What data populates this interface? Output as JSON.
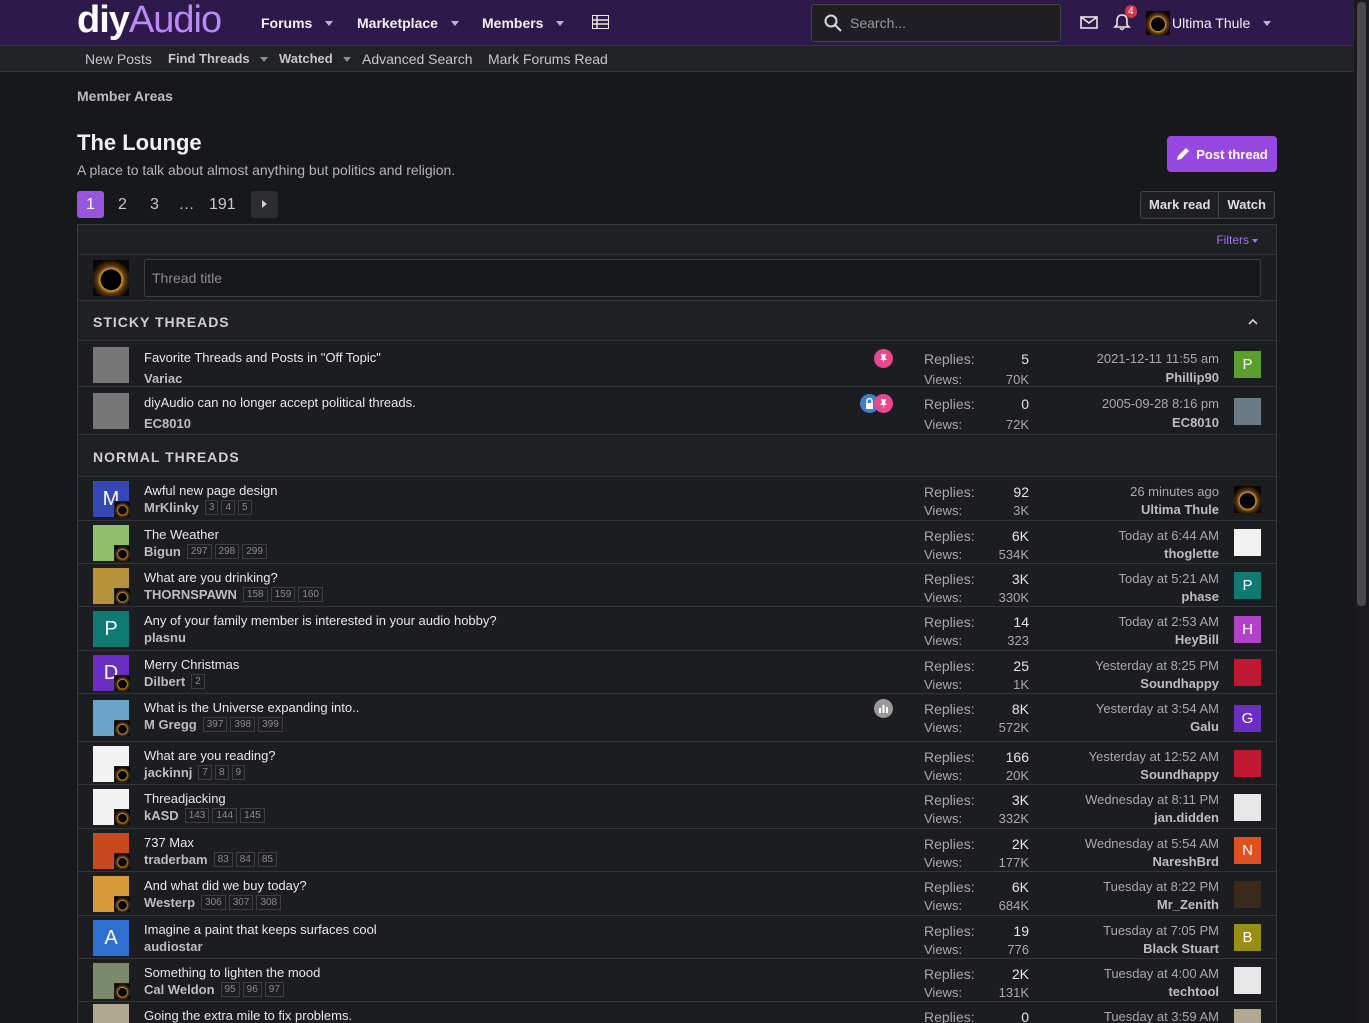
{
  "header": {
    "logo_a": "diy",
    "logo_b": "Audio",
    "nav": [
      "Forums",
      "Marketplace",
      "Members"
    ],
    "search_placeholder": "Search...",
    "notifications_count": "4",
    "username": "Ultima Thule"
  },
  "subnav": {
    "new_posts": "New Posts",
    "find_threads": "Find Threads",
    "watched": "Watched",
    "advanced_search": "Advanced Search",
    "mark_forums_read": "Mark Forums Read"
  },
  "breadcrumb": "Member Areas",
  "page": {
    "title": "The Lounge",
    "description": "A place to talk about almost anything but politics and religion.",
    "post_thread": "Post thread",
    "mark_read": "Mark read",
    "watch": "Watch"
  },
  "pager": [
    "1",
    "2",
    "3",
    "…",
    "191"
  ],
  "filters": "Filters",
  "thread_title_placeholder": "Thread title",
  "sections": {
    "sticky": "STICKY THREADS",
    "normal": "NORMAL THREADS"
  },
  "labels": {
    "replies": "Replies:",
    "views": "Views:"
  },
  "sticky_threads": [
    {
      "title": "Favorite Threads and Posts in \"Off Topic\"",
      "author": "Variac",
      "replies": "5",
      "views": "70K",
      "date": "2021-12-11 11:55 am",
      "last": "Phillip90",
      "last_initial": "P",
      "last_color": "#5a9e2e",
      "icons": [
        "pin"
      ]
    },
    {
      "title": "diyAudio can no longer accept political threads.",
      "author": "EC8010",
      "replies": "0",
      "views": "72K",
      "date": "2005-09-28 8:16 pm",
      "last": "EC8010",
      "last_initial": "",
      "last_color": "#6b7b86",
      "icons": [
        "lock",
        "pin"
      ]
    }
  ],
  "normal_threads": [
    {
      "title": "Awful new page design",
      "author": "MrKlinky",
      "pages": [
        "3",
        "4",
        "5"
      ],
      "replies": "92",
      "views": "3K",
      "date": "26 minutes ago",
      "last": "Ultima Thule",
      "av_initial": "M",
      "av_color": "#3548b8",
      "last_initial": "",
      "last_color": "eclipse"
    },
    {
      "title": "The Weather",
      "author": "Bigun",
      "pages": [
        "297",
        "298",
        "299"
      ],
      "replies": "6K",
      "views": "534K",
      "date": "Today at 6:44 AM",
      "last": "thoglette",
      "av_initial": "",
      "av_color": "#8fbf6a",
      "last_initial": "",
      "last_color": "#f2f2f2"
    },
    {
      "title": "What are you drinking?",
      "author": "THORNSPAWN",
      "pages": [
        "158",
        "159",
        "160"
      ],
      "replies": "3K",
      "views": "330K",
      "date": "Today at 5:21 AM",
      "last": "phase",
      "av_initial": "",
      "av_color": "#b8923a",
      "last_initial": "P",
      "last_color": "#0f7a72"
    },
    {
      "title": "Any of your family member is interested in your audio hobby?",
      "author": "plasnu",
      "pages": [],
      "replies": "14",
      "views": "323",
      "date": "Today at 2:53 AM",
      "last": "HeyBill",
      "av_initial": "P",
      "av_color": "#0f7a72",
      "last_initial": "H",
      "last_color": "#b042c8"
    },
    {
      "title": "Merry Christmas",
      "author": "Dilbert",
      "pages": [
        "2"
      ],
      "replies": "25",
      "views": "1K",
      "date": "Yesterday at 8:25 PM",
      "last": "Soundhappy",
      "av_initial": "D",
      "av_color": "#6a2fc2",
      "last_initial": "",
      "last_color": "#c01830"
    },
    {
      "title": "What is the Universe expanding into..",
      "author": "M Gregg",
      "pages": [
        "397",
        "398",
        "399"
      ],
      "replies": "8K",
      "views": "572K",
      "date": "Yesterday at 3:54 AM",
      "last": "Galu",
      "av_initial": "",
      "av_color": "#6aa3c9",
      "last_initial": "G",
      "last_color": "#6a2fc2",
      "poll": true
    },
    {
      "title": "What are you reading?",
      "author": "jackinnj",
      "pages": [
        "7",
        "8",
        "9"
      ],
      "replies": "166",
      "views": "20K",
      "date": "Yesterday at 12:52 AM",
      "last": "Soundhappy",
      "av_initial": "",
      "av_color": "#f2f2f2",
      "last_initial": "",
      "last_color": "#c01830"
    },
    {
      "title": "Threadjacking",
      "author": "kASD",
      "pages": [
        "143",
        "144",
        "145"
      ],
      "replies": "3K",
      "views": "332K",
      "date": "Wednesday at 8:11 PM",
      "last": "jan.didden",
      "av_initial": "",
      "av_color": "#f2f2f2",
      "last_initial": "",
      "last_color": "#e8e8e8"
    },
    {
      "title": "737 Max",
      "author": "traderbam",
      "pages": [
        "83",
        "84",
        "85"
      ],
      "replies": "2K",
      "views": "177K",
      "date": "Wednesday at 5:54 AM",
      "last": "NareshBrd",
      "av_initial": "",
      "av_color": "#c84a1c",
      "last_initial": "N",
      "last_color": "#e0501f"
    },
    {
      "title": "And what did we buy today?",
      "author": "Westerp",
      "pages": [
        "306",
        "307",
        "308"
      ],
      "replies": "6K",
      "views": "684K",
      "date": "Tuesday at 8:22 PM",
      "last": "Mr_Zenith",
      "av_initial": "",
      "av_color": "#d99a3a",
      "last_initial": "",
      "last_color": "#3a2a1a"
    },
    {
      "title": "Imagine a paint that keeps surfaces cool",
      "author": "audiostar",
      "pages": [],
      "replies": "19",
      "views": "776",
      "date": "Tuesday at 7:05 PM",
      "last": "Black Stuart",
      "av_initial": "A",
      "av_color": "#2f6fd0",
      "last_initial": "B",
      "last_color": "#9a8e12"
    },
    {
      "title": "Something to lighten the mood",
      "author": "Cal Weldon",
      "pages": [
        "95",
        "96",
        "97"
      ],
      "replies": "2K",
      "views": "131K",
      "date": "Tuesday at 4:00 AM",
      "last": "techtool",
      "av_initial": "",
      "av_color": "#7a8a6a",
      "last_initial": "",
      "last_color": "#e8e8e8"
    },
    {
      "title": "Going the extra mile to fix problems.",
      "author": "",
      "pages": [],
      "replies": "0",
      "views": "",
      "date": "Tuesday at 3:59 AM",
      "last": "",
      "av_initial": "",
      "av_color": "#b0a890",
      "last_initial": "",
      "last_color": "#b0a890"
    }
  ]
}
